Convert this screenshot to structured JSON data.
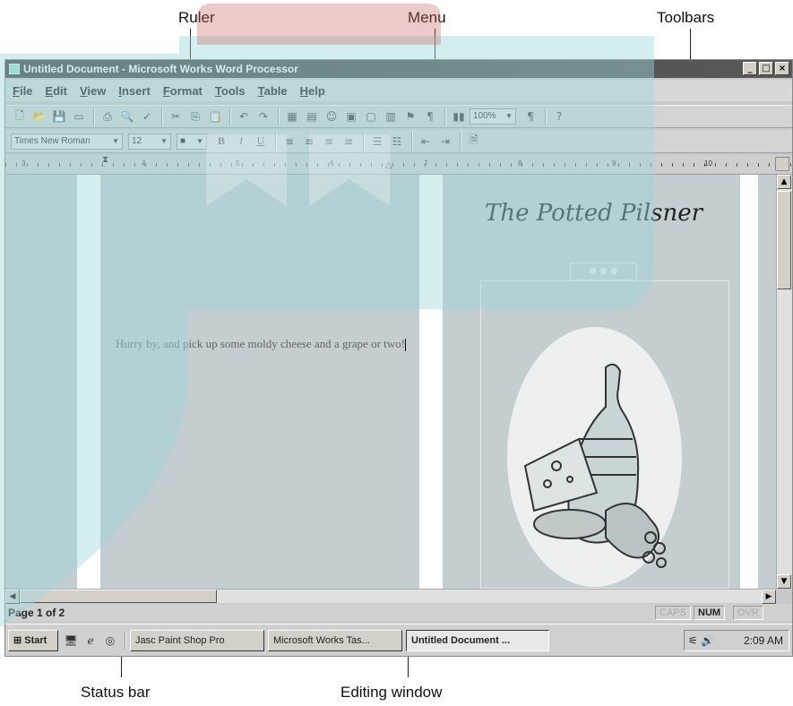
{
  "callouts": {
    "ruler": "Ruler",
    "menu": "Menu",
    "toolbars": "Toolbars",
    "status_bar": "Status bar",
    "editing_window": "Editing window"
  },
  "window": {
    "title": "Untitled Document - Microsoft Works Word Processor",
    "minimize": "_",
    "maximize": "□",
    "close": "×"
  },
  "menu": [
    "File",
    "Edit",
    "View",
    "Insert",
    "Format",
    "Tools",
    "Table",
    "Help"
  ],
  "toolbar2": {
    "font": "Times New Roman",
    "size": "12",
    "zoom": "100%",
    "bold": "B",
    "italic": "I",
    "underline": "U"
  },
  "ruler": {
    "labels": [
      "3",
      "4",
      "5",
      "6",
      "7",
      "8",
      "9",
      "10"
    ]
  },
  "document": {
    "logo": "The Potted Pilsner",
    "text": "Hurry by, and pick up some moldy cheese and a grape or two!"
  },
  "status": {
    "page": "Page 1 of 2",
    "caps": "CAPS",
    "num": "NUM",
    "ovr": "OVR"
  },
  "taskbar": {
    "start": "Start",
    "tasks": [
      "Jasc Paint Shop Pro",
      "Microsoft Works Tas...",
      "Untitled Document ..."
    ],
    "time": "2:09 AM"
  },
  "colors": {
    "overlay": "#9fd6dc",
    "title_bar": "#3c3c3c"
  }
}
